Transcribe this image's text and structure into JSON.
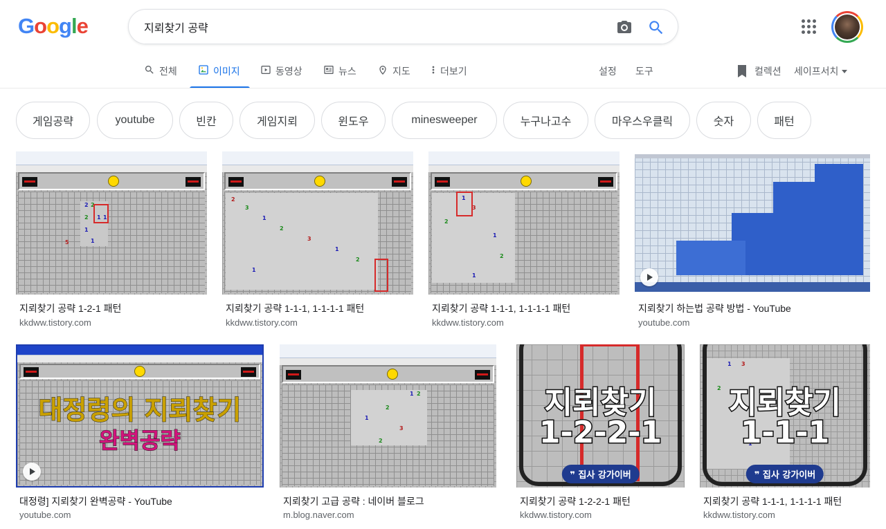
{
  "logo": {
    "letters": [
      "G",
      "o",
      "o",
      "g",
      "l",
      "e"
    ],
    "colors": [
      "#4285f4",
      "#ea4335",
      "#fbbc05",
      "#4285f4",
      "#34a853",
      "#ea4335"
    ]
  },
  "search": {
    "query": "지뢰찾기 공략"
  },
  "tabs": [
    {
      "label": "전체",
      "icon": "search-icon"
    },
    {
      "label": "이미지",
      "icon": "image-icon",
      "active": true
    },
    {
      "label": "동영상",
      "icon": "video-icon"
    },
    {
      "label": "뉴스",
      "icon": "news-icon"
    },
    {
      "label": "지도",
      "icon": "map-pin-icon"
    },
    {
      "label": "더보기",
      "icon": "more-vert-icon"
    }
  ],
  "tools": {
    "settings": "설정",
    "tools": "도구",
    "collections": "컬렉션",
    "safesearch": "세이프서치"
  },
  "chips": [
    "게임공략",
    "youtube",
    "빈칸",
    "게임지뢰",
    "윈도우",
    "minesweeper",
    "누구나고수",
    "마우스우클릭",
    "숫자",
    "패턴"
  ],
  "results": [
    {
      "title": "지뢰찾기 공략 1-2-1 패턴",
      "source": "kkdww.tistory.com"
    },
    {
      "title": "지뢰찾기 공략 1-1-1, 1-1-1-1 패턴",
      "source": "kkdww.tistory.com"
    },
    {
      "title": "지뢰찾기 공략 1-1-1, 1-1-1-1 패턴",
      "source": "kkdww.tistory.com"
    },
    {
      "title": "지뢰찾기 하는법 공략 방법 - YouTube",
      "source": "youtube.com"
    },
    {
      "title": "대정령] 지뢰찾기 완벽공략 - YouTube",
      "source": "youtube.com"
    },
    {
      "title": "지뢰찾기 고급 공략 : 네이버 블로그",
      "source": "m.blog.naver.com"
    },
    {
      "title": "지뢰찾기 공략 1-2-2-1 패턴",
      "source": "kkdww.tistory.com"
    },
    {
      "title": "지뢰찾기 공략 1-1-1, 1-1-1-1 패턴",
      "source": "kkdww.tistory.com"
    }
  ],
  "thumb_text": {
    "yt_line1": "대정령의 지뢰찾기",
    "yt_line2": "완벽공략",
    "pattern_1221_title": "지뢰찾기",
    "pattern_1221_sub": "1-2-2-1",
    "pattern_111_title": "지뢰찾기",
    "pattern_111_sub": "1-1-1",
    "brand": "❞ 집사 강가이버"
  }
}
